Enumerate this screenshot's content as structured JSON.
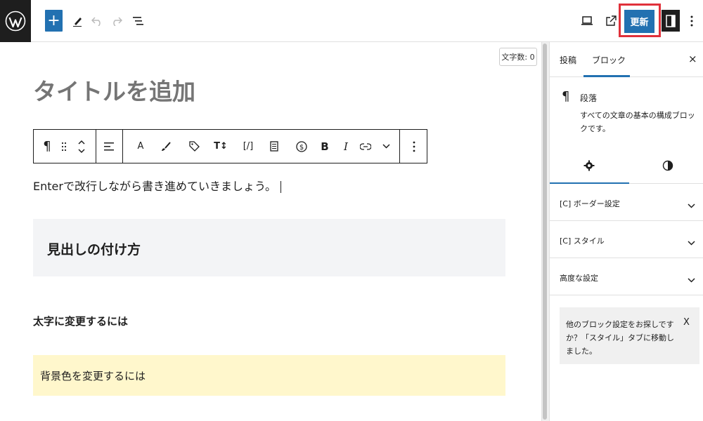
{
  "topbar": {
    "logo_icon": "wordpress-logo",
    "add_block_label": "+",
    "update_label": "更新",
    "icons": [
      "pencil-icon",
      "undo-icon",
      "redo-icon",
      "list-view-icon",
      "preview-icon",
      "external-link-icon",
      "settings-sidebar-icon",
      "more-vertical-icon"
    ],
    "accent": "#2271b1",
    "highlight_border": "#e0313b"
  },
  "editor": {
    "word_count": "文字数: 0",
    "title_placeholder": "タイトルを追加",
    "paragraph": "Enterで改行しながら書き進めていきましょう。",
    "heading": "見出しの付け方",
    "bold_paragraph": "太字に変更するには",
    "highlight_paragraph": "背景色を変更するには",
    "toolbar": {
      "icons": [
        "paragraph-icon",
        "drag-handle-icon",
        "move-up-down-icon",
        "align-icon",
        "text-color-icon",
        "highlight-brush-icon",
        "tag-icon",
        "font-size-icon",
        "shortcode-icon",
        "document-icon",
        "dollar-circle-icon",
        "bold-icon",
        "italic-icon",
        "link-icon",
        "chevron-down-icon",
        "more-options-icon"
      ],
      "paragraph_glyph": "¶",
      "text_color_glyph": "A",
      "bold_glyph": "B",
      "italic_glyph": "I",
      "shortcode_glyph": "[/]"
    }
  },
  "sidebar": {
    "tabs": [
      "投稿",
      "ブロック"
    ],
    "active_tab": "ブロック",
    "close_label": "×",
    "block_card": {
      "glyph": "¶",
      "title": "段落",
      "description": "すべての文章の基本の構成ブロックです。"
    },
    "sub_tabs": [
      "settings-gear-icon",
      "styles-contrast-icon"
    ],
    "panels": [
      {
        "title": "[C] ボーダー設定"
      },
      {
        "title": "[C] スタイル"
      },
      {
        "title": "高度な設定"
      }
    ],
    "notice": {
      "text": "他のブロック設定をお探しですか？「スタイル」タブに移動しました。",
      "close_label": "X"
    }
  }
}
